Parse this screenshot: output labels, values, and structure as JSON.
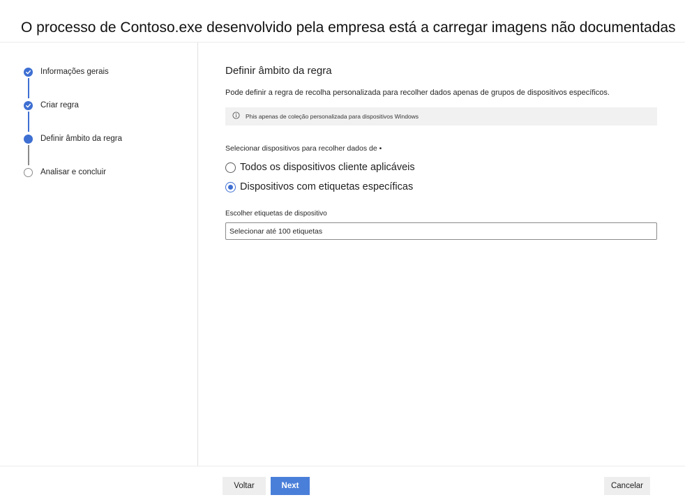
{
  "page": {
    "title": "O processo de Contoso.exe desenvolvido pela empresa está a carregar imagens não documentadas"
  },
  "wizard": {
    "steps": [
      {
        "label": "Informações gerais",
        "state": "done"
      },
      {
        "label": "Criar regra",
        "state": "done"
      },
      {
        "label": "Definir âmbito da regra",
        "state": "current"
      },
      {
        "label": "Analisar e concluir",
        "state": "pending"
      }
    ]
  },
  "main": {
    "section_title": "Definir âmbito da regra",
    "description": "Pode definir a regra de recolha personalizada para recolher dados apenas de grupos de dispositivos específicos.",
    "info_text": "Phis apenas de coleção personalizada para dispositivos Windows",
    "select_label": "Selecionar dispositivos para recolher dados de •",
    "options": [
      {
        "label": "Todos os dispositivos cliente aplicáveis",
        "checked": false
      },
      {
        "label": "Dispositivos com etiquetas específicas",
        "checked": true
      }
    ],
    "tags_label": "Escolher etiquetas de dispositivo",
    "tags_placeholder": "Selecionar até 100 etiquetas"
  },
  "footer": {
    "back_label": "Voltar",
    "next_label": "Next",
    "cancel_label": "Cancelar"
  },
  "colors": {
    "accent": "#3e6fd2",
    "primary_button": "#4a7fd9",
    "info_bar_bg": "#f1f1f1"
  }
}
